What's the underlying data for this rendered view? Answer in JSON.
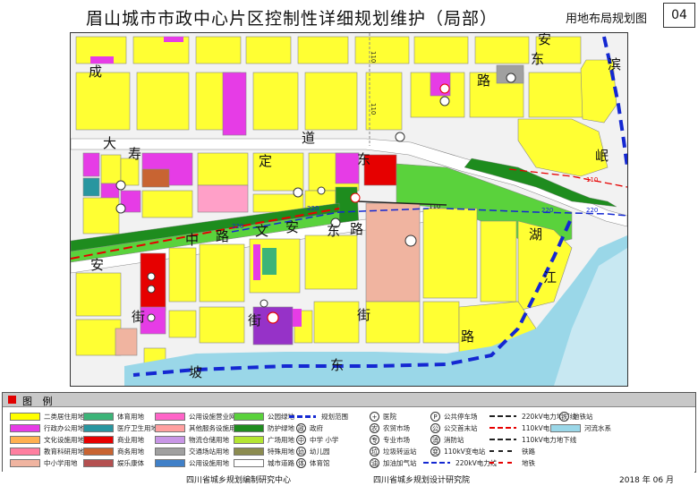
{
  "header": {
    "title": "眉山城市市政中心片区控制性详细规划维护（局部）",
    "subtitle": "用地布局规划图",
    "sheet_number": "04"
  },
  "map": {
    "street_labels": {
      "cheng": "成",
      "an_dong": "安",
      "dong_top": "东",
      "bin": "滨",
      "lu_top": "路",
      "da": "大",
      "dao": "道",
      "dong_big": "东",
      "min": "岷",
      "hu": "湖",
      "jiang": "江",
      "zhong": "中",
      "lu_mid": "路",
      "wen": "文",
      "an_mid": "安",
      "dong_mid": "东",
      "lu_mid2": "路",
      "an_left": "安",
      "jie_left": "街",
      "jie_mid": "街",
      "jie_right": "街",
      "lu_bottom": "路",
      "po": "坡",
      "dong_bottom": "东",
      "ding": "定",
      "shou": "寿"
    },
    "line_labels": {
      "v110_a": "110",
      "v110_b": "110",
      "v110_c": "110",
      "v220_a": "220",
      "v220_b": "220",
      "v220_c": "220",
      "v220_d": "220",
      "v110_d": "110"
    }
  },
  "legend": {
    "title": "图  例",
    "columns": [
      [
        {
          "label": "二类居住用地",
          "color": "#ffff00"
        },
        {
          "label": "行政办公用地",
          "color": "#e63ce6"
        },
        {
          "label": "文化设施用地",
          "color": "#ffb050"
        },
        {
          "label": "教育科研用地",
          "color": "#ff7fa0"
        },
        {
          "label": "中小学用地",
          "color": "#f0b4a0"
        }
      ],
      [
        {
          "label": "体育用地",
          "color": "#3cb478"
        },
        {
          "label": "医疗卫生用地",
          "color": "#2896a0"
        },
        {
          "label": "商业用地",
          "color": "#e60000"
        },
        {
          "label": "商务用地",
          "color": "#c86432"
        },
        {
          "label": "娱乐康体",
          "color": "#b45050"
        }
      ],
      [
        {
          "label": "公用设施营业网点用地",
          "color": "#ff64c8"
        },
        {
          "label": "其他服务设施用地",
          "color": "#ffa0a0"
        },
        {
          "label": "物流仓储用地",
          "color": "#c896e6"
        },
        {
          "label": "交通场站用地",
          "color": "#a0a0a0"
        },
        {
          "label": "公用设施用地",
          "color": "#4080c8"
        }
      ],
      [
        {
          "label": "公园绿地",
          "color": "#5ad23c"
        },
        {
          "label": "防护绿地",
          "color": "#1e8c1e"
        },
        {
          "label": "广场用地",
          "color": "#b4e632"
        },
        {
          "label": "特殊用地",
          "color": "#8c8c50"
        },
        {
          "label": "城市道路",
          "color": "#ffffff"
        }
      ]
    ],
    "symbols_a": [
      {
        "label": "规划范围",
        "kind": "dash-blue"
      },
      {
        "label": "政府",
        "kind": "circle",
        "glyph": "政"
      },
      {
        "label": "中学  小学",
        "kind": "circle2",
        "glyph": "中"
      },
      {
        "label": "幼儿园",
        "kind": "circle",
        "glyph": "幼"
      },
      {
        "label": "体育馆",
        "kind": "circle",
        "glyph": "体"
      }
    ],
    "symbols_b": [
      {
        "label": "医院",
        "kind": "circle",
        "glyph": "+"
      },
      {
        "label": "农贸市场",
        "kind": "circle",
        "glyph": "农"
      },
      {
        "label": "专业市场",
        "kind": "circle",
        "glyph": "专"
      },
      {
        "label": "垃圾转运站",
        "kind": "circle",
        "glyph": "垃"
      },
      {
        "label": "加油加气站",
        "kind": "circle",
        "glyph": "油"
      }
    ],
    "symbols_c": [
      {
        "label": "公共停车场",
        "kind": "circle",
        "glyph": "P"
      },
      {
        "label": "公交首末站",
        "kind": "circle",
        "glyph": "公"
      },
      {
        "label": "消防站",
        "kind": "circle",
        "glyph": "消"
      },
      {
        "label": "110kV变电站",
        "kind": "circle",
        "glyph": "变"
      },
      {
        "label": "220kV电力线",
        "kind": "line-blue"
      }
    ],
    "symbols_d": [
      {
        "label": "220kV电力地下线",
        "kind": "line-black"
      },
      {
        "label": "110kV电力线",
        "kind": "line-red"
      },
      {
        "label": "110kV电力地下线",
        "kind": "line-black"
      },
      {
        "label": "铁路",
        "kind": "line-rail"
      },
      {
        "label": "地铁",
        "kind": "line-metro"
      }
    ],
    "symbols_e": [
      {
        "label": "地铁站",
        "kind": "circle",
        "glyph": "铁"
      },
      {
        "label": "河流水系",
        "kind": "water"
      }
    ]
  },
  "footer": {
    "left": "四川省城乡规划编制研究中心",
    "middle": "四川省城乡规划设计研究院",
    "date": "2018 年 06 月"
  }
}
